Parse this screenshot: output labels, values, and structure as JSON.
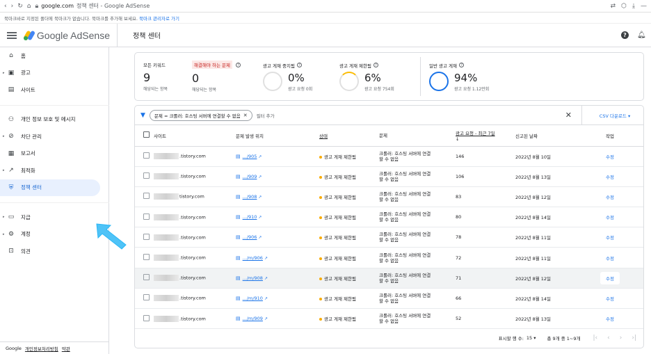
{
  "browser": {
    "url_domain": "google.com",
    "url_rest": "정책 센터 - Google AdSense",
    "bookmark_msg": "북마크바로 지정된 폴더에 북마크가 없습니다. 북마크를 추가해 보세요.",
    "bookmark_link": "북마크 관리자로 가기"
  },
  "header": {
    "logo_text": "Google AdSense",
    "title": "정책 센터"
  },
  "sidebar": {
    "items": [
      {
        "label": "홈",
        "icon": "home-icon",
        "glyph": "⌂",
        "caret": false
      },
      {
        "label": "광고",
        "icon": "ads-icon",
        "glyph": "▣",
        "caret": true
      },
      {
        "label": "사이트",
        "icon": "sites-icon",
        "glyph": "▤",
        "caret": false
      },
      {
        "label": "개인 정보 보호 및 메시지",
        "icon": "privacy-icon",
        "glyph": "⚇",
        "caret": false
      },
      {
        "label": "차단 관리",
        "icon": "block-icon",
        "glyph": "⊘",
        "caret": true
      },
      {
        "label": "보고서",
        "icon": "reports-icon",
        "glyph": "▦",
        "caret": false
      },
      {
        "label": "최적화",
        "icon": "optimize-icon",
        "glyph": "↗",
        "caret": true
      },
      {
        "label": "정책 센터",
        "icon": "policy-shield-icon",
        "glyph": "⛨",
        "caret": false
      },
      {
        "label": "지급",
        "icon": "payments-icon",
        "glyph": "▭",
        "caret": true
      },
      {
        "label": "계정",
        "icon": "account-gear-icon",
        "glyph": "⚙",
        "caret": true
      },
      {
        "label": "의견",
        "icon": "feedback-icon",
        "glyph": "⊡",
        "caret": false
      }
    ],
    "footer": {
      "brand": "Google",
      "privacy": "개인정보처리방침",
      "terms": "약관"
    }
  },
  "stats": {
    "all_issues": {
      "label": "모든 키워드",
      "value": "9",
      "sub": "해당되는 항목"
    },
    "must_fix": {
      "label": "해결해야 하는 문제",
      "value": "0",
      "sub": "해당되는 항목"
    },
    "ads_stopped": {
      "label": "광고 게재 중지됨",
      "value": "0%",
      "sub": "광고 요청 0회"
    },
    "ads_limited": {
      "label": "광고 게재 제한됨",
      "value": "6%",
      "sub": "광고 요청 754회"
    },
    "ads_normal": {
      "label": "일반 광고 게재",
      "value": "94%",
      "sub": "광고 요청 1.12만회"
    }
  },
  "filter": {
    "chip": "문제 = 크롤러: 호스팅 서버에 연결할 수 없음",
    "add": "필터 추가",
    "csv": "CSV 다운로드 ▾"
  },
  "table": {
    "headers": {
      "site": "사이트",
      "page": "문제 발생 위치",
      "status": "상태",
      "issue": "문제",
      "requests": "광고 요청 - 최근 7일",
      "date": "신고된 날짜",
      "action": "작업"
    },
    "rows": [
      {
        "site": ".tistory.com",
        "page": ".../905",
        "status": "광고 게재 제한됨",
        "issue1": "크롤러: 호스팅 서버에 연결",
        "issue2": "할 수 없음",
        "requests": "146",
        "date": "2022년 8월 10일",
        "action": "수정"
      },
      {
        "site": ".tistory.com",
        "page": ".../909",
        "status": "광고 게재 제한됨",
        "issue1": "크롤러: 호스팅 서버에 연결",
        "issue2": "할 수 없음",
        "requests": "106",
        "date": "2022년 8월 13일",
        "action": "수정"
      },
      {
        "site": "tistory.com",
        "page": ".../908",
        "status": "광고 게재 제한됨",
        "issue1": "크롤러: 호스팅 서버에 연결",
        "issue2": "할 수 없음",
        "requests": "83",
        "date": "2022년 8월 12일",
        "action": "수정"
      },
      {
        "site": ".tistory.com",
        "page": ".../910",
        "status": "광고 게재 제한됨",
        "issue1": "크롤러: 호스팅 서버에 연결",
        "issue2": "할 수 없음",
        "requests": "80",
        "date": "2022년 8월 14일",
        "action": "수정"
      },
      {
        "site": ".tistory.com",
        "page": ".../906",
        "status": "광고 게재 제한됨",
        "issue1": "크롤러: 호스팅 서버에 연결",
        "issue2": "할 수 없음",
        "requests": "78",
        "date": "2022년 8월 11일",
        "action": "수정"
      },
      {
        "site": ".tistory.com",
        "page": ".../m/906",
        "status": "광고 게재 제한됨",
        "issue1": "크롤러: 호스팅 서버에 연결",
        "issue2": "할 수 없음",
        "requests": "72",
        "date": "2022년 8월 11일",
        "action": "수정"
      },
      {
        "site": ".tistory.com",
        "page": ".../m/908",
        "status": "광고 게재 제한됨",
        "issue1": "크롤러: 호스팅 서버에 연결",
        "issue2": "할 수 없음",
        "requests": "71",
        "date": "2022년 8월 12일",
        "action": "수정"
      },
      {
        "site": ".tistory.com",
        "page": ".../m/910",
        "status": "광고 게재 제한됨",
        "issue1": "크롤러: 호스팅 서버에 연결",
        "issue2": "할 수 없음",
        "requests": "66",
        "date": "2022년 8월 14일",
        "action": "수정"
      },
      {
        "site": ".tistory.com",
        "page": ".../m/909",
        "status": "광고 게재 제한됨",
        "issue1": "크롤러: 호스팅 서버에 연결",
        "issue2": "할 수 없음",
        "requests": "52",
        "date": "2022년 8월 13일",
        "action": "수정"
      }
    ]
  },
  "pager": {
    "rows_label": "표시할 행 수:",
    "rows_value": "15 ▾",
    "range": "총 9개 중 1~9개"
  }
}
